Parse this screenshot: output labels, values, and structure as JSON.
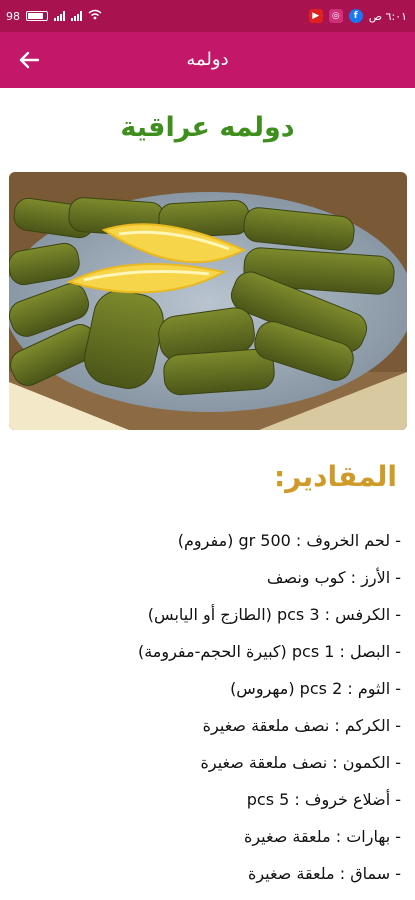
{
  "status_bar": {
    "time": "٦:٠١ ص",
    "battery": "98",
    "app_icons": [
      "youtube-icon",
      "instagram-icon",
      "facebook-icon"
    ]
  },
  "toolbar": {
    "title": "دولمه"
  },
  "recipe": {
    "title": "دولمه عراقية",
    "ingredients_heading": "المقادير:",
    "ingredients": [
      "- لحم الخروف : 500 gr (مفروم)",
      "- الأرز : كوب ونصف",
      "- الكرفس : 3 pcs (الطازج أو اليابس)",
      "- البصل : 1 pcs (كبيرة الحجم-مفرومة)",
      "- الثوم : 2 pcs (مهروس)",
      "- الكركم : نصف ملعقة صغيرة",
      "- الكمون : نصف ملعقة صغيرة",
      "- أضلاع خروف : 5 pcs",
      "- بهارات : ملعقة صغيرة",
      "- سماق : ملعقة صغيرة"
    ]
  },
  "colors": {
    "status_bar": "#a8124f",
    "toolbar": "#c3176a",
    "title_green": "#3f8f1f",
    "heading_gold": "#cf9a27"
  }
}
